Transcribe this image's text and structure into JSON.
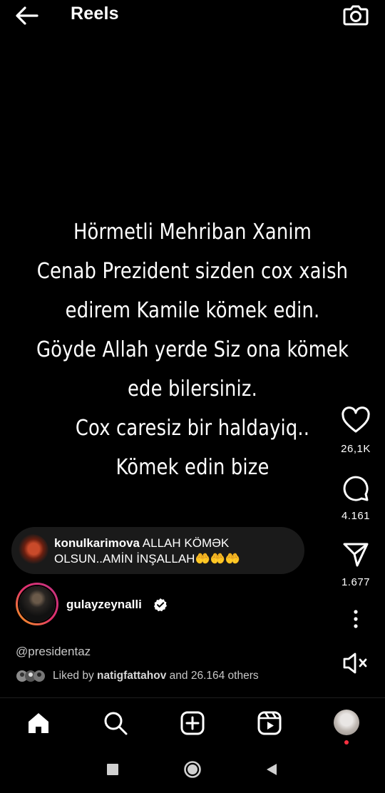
{
  "header": {
    "title": "Reels"
  },
  "caption_lines": [
    "Hörmetli Mehriban Xanim",
    "Cenab Prezident sizden cox xaish",
    "edirem Kamile kömek edin.",
    "Göyde Allah yerde Siz ona kömek",
    "ede bilersiniz.",
    "Cox caresiz bir haldayiq..",
    "Kömek edin bize"
  ],
  "actions": {
    "likes": "26,1K",
    "comments": "4.161",
    "shares": "1.677"
  },
  "top_comment": {
    "username": "konulkarimova",
    "text": "ALLAH KÖMƏK OLSUN..AMİN İNŞALLAH",
    "emoji": "🤲🤲🤲"
  },
  "author": {
    "username": "gulayzeynalli",
    "verified": true
  },
  "mention": "@presidentaz",
  "liked_by": {
    "prefix": "Liked by",
    "user": "natigfattahov",
    "suffix": "and 26.164 others"
  },
  "colors": {
    "background": "#000000",
    "notification": "#ff3040",
    "emoji": "#f2c230"
  }
}
